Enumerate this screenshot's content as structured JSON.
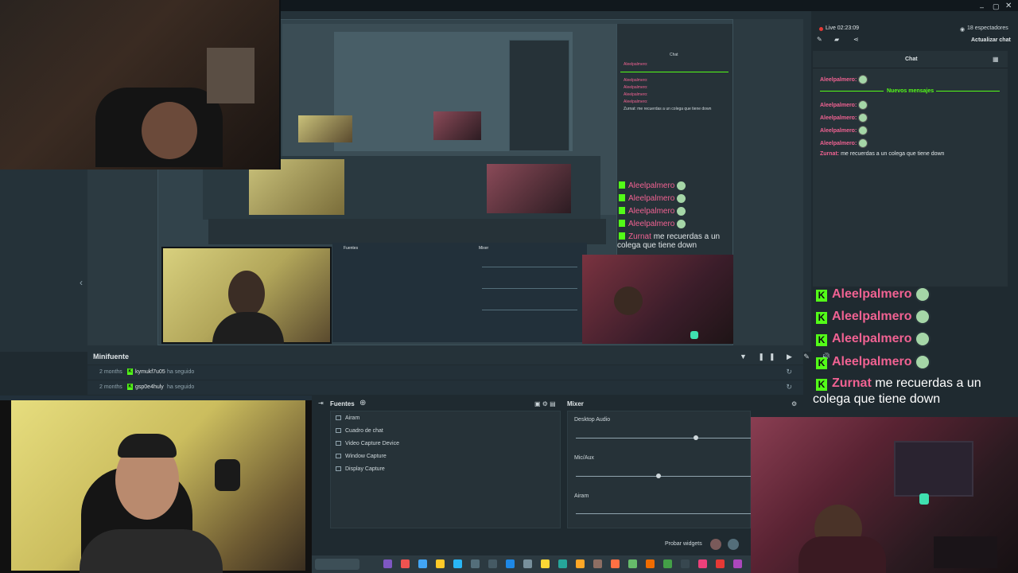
{
  "stream_status": {
    "live_label": "Live 02:23:09",
    "viewers": "18 espectadores",
    "update_chat": "Actualizar chat"
  },
  "chat": {
    "title": "Chat",
    "first_user": "Aleelpalmero:",
    "new_messages": "Nuevos mensajes",
    "repeat_users": [
      "Aleelpalmero:",
      "Aleelpalmero:",
      "Aleelpalmero:",
      "Aleelpalmero:"
    ],
    "last_user": "Zurnat:",
    "last_message": "me recuerdas a un colega que tiene down"
  },
  "overlay_chat": {
    "lines": [
      "Aleelpalmero",
      "Aleelpalmero",
      "Aleelpalmero",
      "Aleelpalmero"
    ],
    "last_user": "Zurnat",
    "last_message_line1": "me recuerdas a un",
    "last_message_line2": "colega que tiene down"
  },
  "minifeed": {
    "title": "Minifuente",
    "rows": [
      {
        "time": "2 months",
        "user": "kymukf7u05",
        "action": "ha seguido"
      },
      {
        "time": "2 months",
        "user": "gsp0e4huly",
        "action": "ha seguido"
      }
    ]
  },
  "sources": {
    "title": "Fuentes",
    "items": [
      "Airam",
      "Cuadro de chat",
      "Video Capture Device",
      "Window Capture",
      "Display Capture"
    ]
  },
  "mixer": {
    "title": "Mixer",
    "channels": [
      {
        "name": "Desktop Audio",
        "level": 0.68
      },
      {
        "name": "Mic/Aux",
        "level": 0.47
      },
      {
        "name": "Airam",
        "level": 0.0
      }
    ],
    "test_widgets": "Probar widgets"
  },
  "colors": {
    "kick_green": "#53fc18",
    "username_pink": "#f06292",
    "panel_bg": "#263238"
  }
}
